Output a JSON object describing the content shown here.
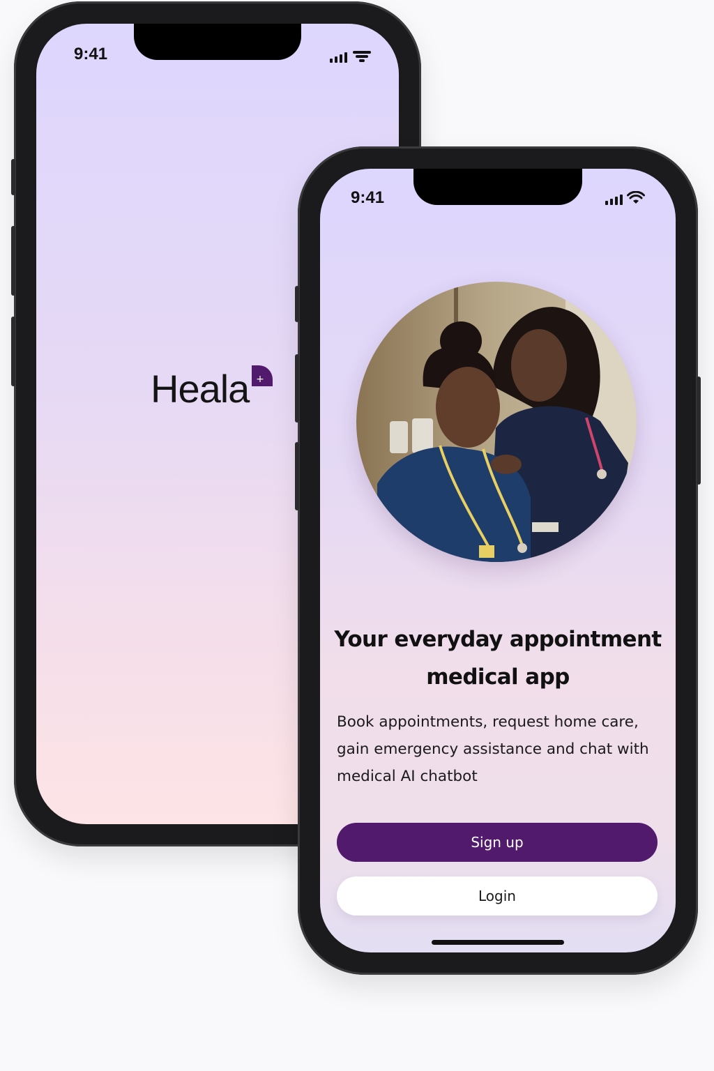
{
  "splash_screen": {
    "status_bar": {
      "time": "9:41",
      "icons": [
        "cellular-signal-icon",
        "wifi-icon"
      ]
    },
    "logo": {
      "wordmark": "Heala",
      "mark_icon": "plus-badge-icon",
      "mark_symbol": "+"
    }
  },
  "onboarding_screen": {
    "status_bar": {
      "time": "9:41",
      "icons": [
        "cellular-signal-icon",
        "wifi-icon"
      ]
    },
    "hero_image": "two-nurses-in-scrubs-with-stethoscopes-photo",
    "headline": "Your everyday appointment medical app",
    "description": "Book appointments, request home care, gain emergency assistance and chat with medical AI chatbot",
    "primary_button": "Sign up",
    "secondary_button": "Login"
  },
  "colors": {
    "brand_primary": "#521a6c",
    "gradient_top": "#ddd6fd",
    "gradient_bottom": "#fde4e6",
    "text_dark": "#111111",
    "button_secondary_bg": "#ffffff"
  }
}
